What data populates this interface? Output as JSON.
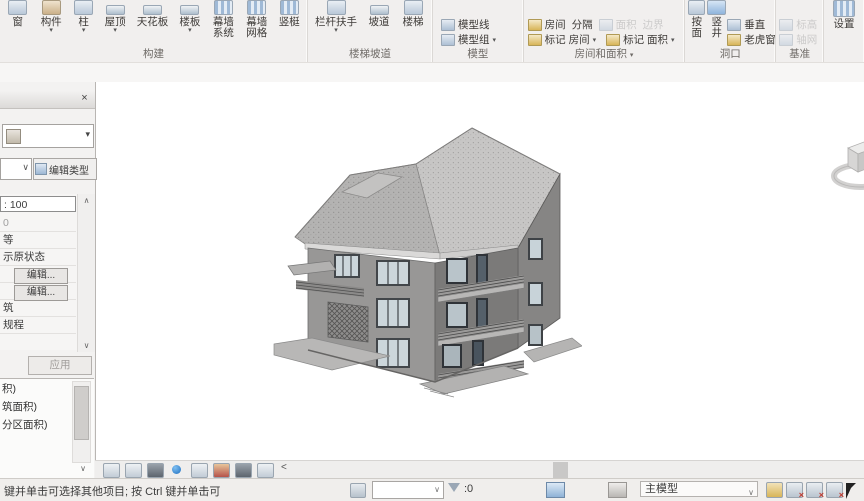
{
  "glyphs": {
    "dropdown": "▾",
    "combo_down": "∨",
    "scroll_up": "∧",
    "scroll_down": "∨",
    "close": "×",
    "collapse_left": "<",
    "red_x": "×"
  },
  "colors": {
    "chrome": "#f0eeec",
    "canvas": "#ffffff",
    "accent_blue": "#3f76b5",
    "wall_light": "#989796",
    "wall_dark": "#7b7a79",
    "roof_speckle": "#c6c5c4",
    "disabled_text": "#9f9f9f"
  },
  "ribbon": {
    "g_build": {
      "label": "构建",
      "b": [
        "窗",
        "构件",
        "柱",
        "屋顶",
        "天花板",
        "楼板",
        "幕墙系统",
        "幕墙网格",
        "竖梃"
      ]
    },
    "g_circ": {
      "label": "楼梯坡道",
      "b": [
        "栏杆扶手",
        "坡道",
        "楼梯"
      ]
    },
    "g_model": {
      "label": "模型",
      "b": [
        "模型线",
        "模型组"
      ]
    },
    "g_room": {
      "label": "房间和面积",
      "b": [
        "房间",
        "分隔",
        "面积",
        "边界",
        "标记 房间",
        "标记 面积"
      ]
    },
    "g_open": {
      "label": "洞口",
      "b": [
        "按面",
        "竖井",
        "垂直",
        "老虎窗"
      ]
    },
    "g_datum": {
      "label": "基准",
      "b": [
        "标高",
        "轴网"
      ]
    },
    "g_set": {
      "b": [
        "设置"
      ]
    }
  },
  "panel": {
    "edit_type": "编辑类型",
    "rows": [
      ": 100",
      "0",
      "等",
      "示原状态",
      "编辑...",
      "编辑...",
      "筑",
      "规程"
    ],
    "apply": "应用"
  },
  "browser": {
    "items": [
      "积)",
      "筑面积)",
      "分区面积)"
    ]
  },
  "vcb": {
    "icons": [
      "scale-icon",
      "detail-level-icon",
      "visual-style-icon",
      "sun-path-icon",
      "shadows-icon",
      "crop-view-icon",
      "render-icon",
      "show-crop-region-icon"
    ]
  },
  "status": {
    "hint": "键并单击可选择其他项目; 按 Ctrl 键并单击可",
    "selection_count": ":0",
    "design_option": "主模型"
  }
}
